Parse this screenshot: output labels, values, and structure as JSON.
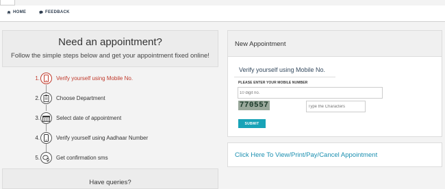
{
  "nav": {
    "home_label": "HOME",
    "feedback_label": "FEEDBACK"
  },
  "left": {
    "title": "Need an appointment?",
    "subtitle": "Follow the simple steps below and get your appointment fixed online!",
    "steps": [
      {
        "num": "1.",
        "label": "Verify yourself using Mobile No.",
        "icon": "mobile-icon"
      },
      {
        "num": "2.",
        "label": "Choose Department",
        "icon": "clipboard-icon"
      },
      {
        "num": "3.",
        "label": "Select date of appointment",
        "icon": "calendar-icon"
      },
      {
        "num": "4.",
        "label": "Verify yourself using Aadhaar Number",
        "icon": "mobile-icon"
      },
      {
        "num": "5.",
        "label": "Get confirmation sms",
        "icon": "chat-icon"
      }
    ],
    "queries_title": "Have queries?"
  },
  "panel": {
    "title": "New Appointment",
    "verify_title": "Verify yourself using Mobile No.",
    "mobile_label": "PLEASE ENTER YOUR MOBILE NUMBER",
    "mobile_placeholder": "10 digit no.",
    "captcha_text": "770557",
    "captcha_placeholder": "Type the Characters",
    "submit_label": "SUBMIT"
  },
  "link": {
    "text": "Click Here To View/Print/Pay/Cancel Appointment"
  },
  "colors": {
    "active_step": "#c0392b",
    "submit_button": "#18a3b7",
    "link": "#1a8fb0",
    "nav_text": "#2e3d4f"
  }
}
